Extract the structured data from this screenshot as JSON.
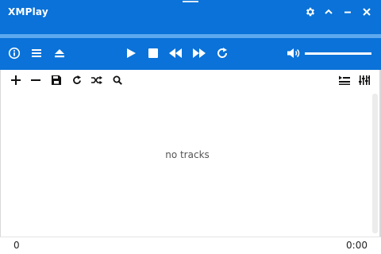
{
  "app": {
    "title": "XMPlay"
  },
  "titlebar": {
    "buttons": [
      "gear-icon",
      "chevron-up-icon",
      "minimize-icon",
      "close-icon"
    ]
  },
  "playback": {
    "position_fraction": 0.0
  },
  "controls": {
    "left_icons": [
      "info-icon",
      "menu-icon",
      "eject-icon"
    ],
    "transport_icons": [
      "play-icon",
      "stop-icon",
      "previous-icon",
      "next-icon",
      "repeat-icon"
    ],
    "volume_icon": "speaker-icon",
    "volume_level": 1.0
  },
  "playlist_toolbar": {
    "left_icons": [
      "plus-icon",
      "minus-icon",
      "save-icon",
      "reload-icon",
      "shuffle-icon",
      "search-icon"
    ],
    "right_icons": [
      "queue-icon",
      "equalizer-icon"
    ]
  },
  "playlist": {
    "empty_message": "no tracks"
  },
  "status": {
    "track_count": "0",
    "total_time": "0:00"
  },
  "colors": {
    "accent": "#0a72d8",
    "track": "#5ea9ee",
    "foreground": "#ffffff"
  }
}
